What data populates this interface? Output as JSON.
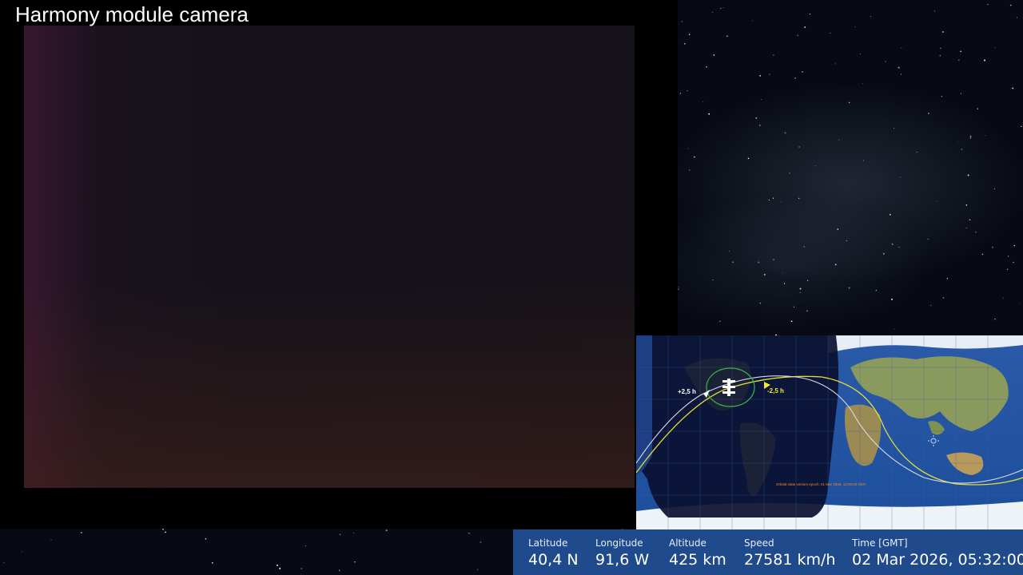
{
  "camera": {
    "title": "Harmony module camera"
  },
  "map": {
    "orbit_labels": {
      "past": "+2,5 h",
      "future": "-2,5 h"
    },
    "note": "Orbital state vectors epoch: 01 Mar 2026, 12:00:00 GMT"
  },
  "telemetry": {
    "latitude": {
      "label": "Latitude",
      "value": "40,4 N"
    },
    "longitude": {
      "label": "Longitude",
      "value": "91,6 W"
    },
    "altitude": {
      "label": "Altitude",
      "value": "425 km"
    },
    "speed": {
      "label": "Speed",
      "value": "27581 km/h"
    },
    "time": {
      "label": "Time [GMT]",
      "value": "02 Mar 2026, 05:32:00"
    }
  },
  "colors": {
    "telemetry_bar": "#1f4a8c",
    "orbit_future": "#e0dc3a",
    "orbit_past": "#d8dde6"
  }
}
